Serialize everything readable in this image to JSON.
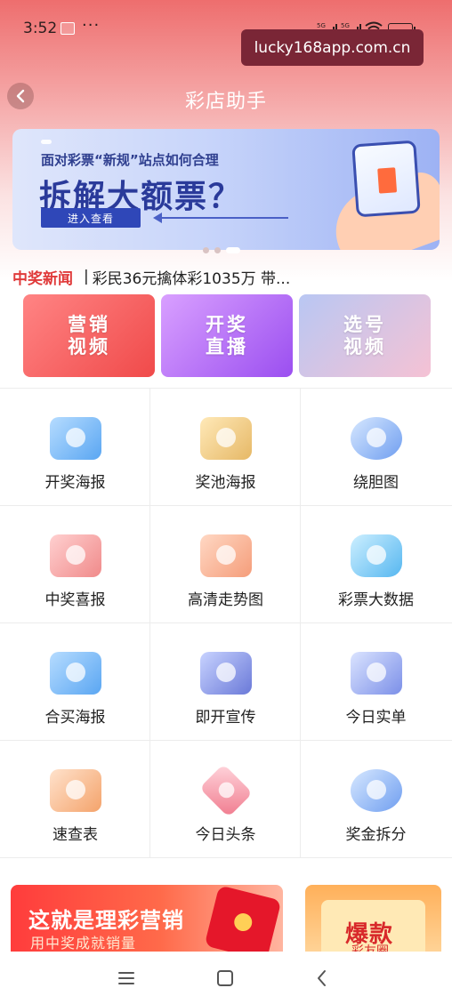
{
  "status_bar": {
    "time": "3:52",
    "dots": "···",
    "sim1": "5G",
    "sim2": "5G",
    "battery": "98"
  },
  "watermark": "lucky168app.com.cn",
  "header": {
    "title": "彩店助手"
  },
  "banner": {
    "subtitle": "面对彩票“新规”站点如何合理",
    "headline": "拆解大额票？",
    "cta": "进入查看",
    "page_count": 3,
    "active_index": 2
  },
  "news": {
    "label": "中奖新闻",
    "separator": "|",
    "text": "彩民36元擒体彩1035万 带..."
  },
  "feature_cards": [
    {
      "line1": "营销",
      "line2": "视频"
    },
    {
      "line1": "开奖",
      "line2": "直播"
    },
    {
      "line1": "选号",
      "line2": "视频"
    }
  ],
  "tools": [
    {
      "label": "开奖海报",
      "icon": "lottery-poster-icon"
    },
    {
      "label": "奖池海报",
      "icon": "jackpot-poster-icon"
    },
    {
      "label": "绕胆图",
      "icon": "chat-bubble-icon"
    },
    {
      "label": "中奖喜报",
      "icon": "winning-report-icon"
    },
    {
      "label": "高清走势图",
      "icon": "trend-chart-icon"
    },
    {
      "label": "彩票大数据",
      "icon": "big-data-icon"
    },
    {
      "label": "合买海报",
      "icon": "group-buy-poster-icon"
    },
    {
      "label": "即开宣传",
      "icon": "instant-ticket-icon"
    },
    {
      "label": "今日实单",
      "icon": "calendar-icon"
    },
    {
      "label": "速查表",
      "icon": "quick-lookup-icon"
    },
    {
      "label": "今日头条",
      "icon": "headline-icon"
    },
    {
      "label": "奖金拆分",
      "icon": "prize-split-icon"
    }
  ],
  "promos": {
    "left_title": "这就是理彩营销",
    "left_subtitle": "用中奖成就销量",
    "right_title": "爆款",
    "right_subtitle": "彩友圈"
  },
  "colors": {
    "accent_red": "#e03a3a",
    "header_top": "#ee6e6e",
    "watermark_bg": "#7a2636"
  }
}
